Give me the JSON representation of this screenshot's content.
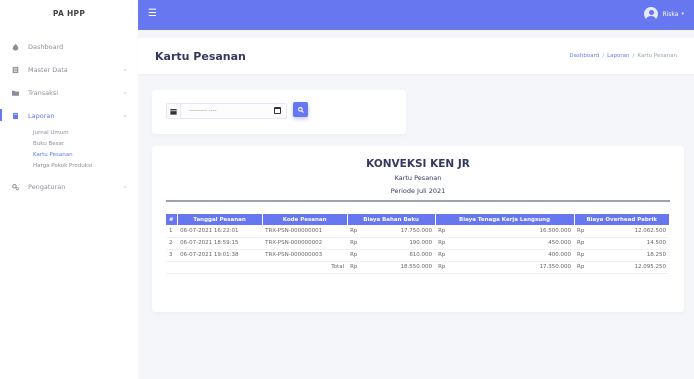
{
  "brand": "PA HPP",
  "sidebar": {
    "items": [
      {
        "label": "Dashboard"
      },
      {
        "label": "Master Data"
      },
      {
        "label": "Transaksi"
      },
      {
        "label": "Laporan"
      },
      {
        "label": "Pengaturan"
      }
    ],
    "laporan_sub": [
      {
        "label": "Jurnal Umum"
      },
      {
        "label": "Buku Besar"
      },
      {
        "label": "Kartu Pesanan"
      },
      {
        "label": "Harga Pokok Produksi"
      }
    ]
  },
  "topbar": {
    "user_name": "Riska",
    "menu_icon": "hamburger-icon"
  },
  "header": {
    "title": "Kartu Pesanan",
    "breadcrumb": [
      "Dashboard",
      "Laporan",
      "Kartu Pesanan"
    ]
  },
  "filter": {
    "date_placeholder": "--------- ----"
  },
  "report": {
    "company": "KONVEKSI KEN JR",
    "subtitle": "Kartu Pesanan",
    "period": "Periode Juli 2021",
    "columns": [
      "#",
      "Tanggal Pesanan",
      "Kode Pesanan",
      "Biaya Bahan Baku",
      "Biaya Tenaga Kerja Langsung",
      "Biaya Overhead Pabrik"
    ],
    "currency": "Rp",
    "rows": [
      {
        "no": "1",
        "tanggal": "06-07-2021 16:22:01",
        "kode": "TRX-PSN-000000001",
        "bahan": "17.750.000",
        "tenaga": "16.500.000",
        "overhead": "12.062.500"
      },
      {
        "no": "2",
        "tanggal": "06-07-2021 18:59:15",
        "kode": "TRX-PSN-000000002",
        "bahan": "190.000",
        "tenaga": "450.000",
        "overhead": "14.500"
      },
      {
        "no": "3",
        "tanggal": "06-07-2021 19:01:38",
        "kode": "TRX-PSN-000000003",
        "bahan": "610.000",
        "tenaga": "400.000",
        "overhead": "18.250"
      }
    ],
    "total": {
      "label": "Total",
      "bahan": "18.550.000",
      "tenaga": "17.350.000",
      "overhead": "12.095.250"
    }
  },
  "colors": {
    "primary": "#6777ef",
    "background": "#f4f6f9"
  }
}
